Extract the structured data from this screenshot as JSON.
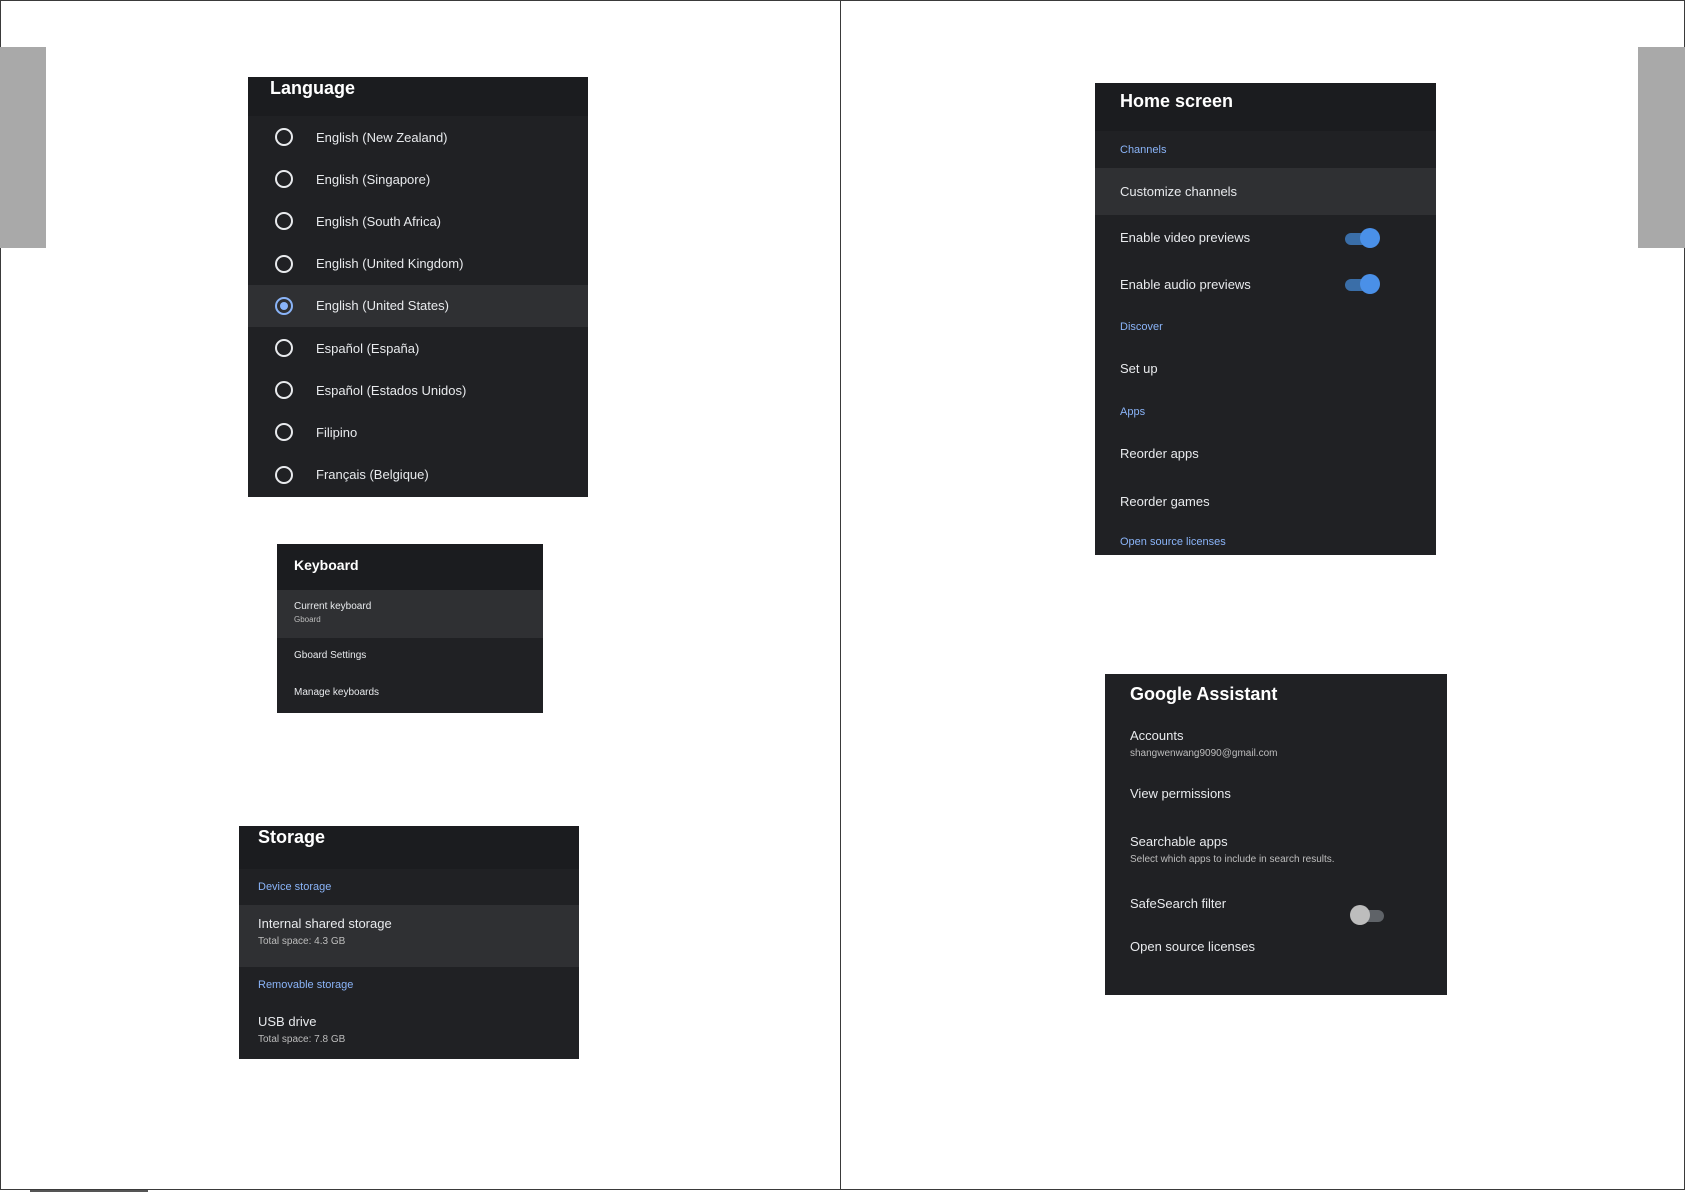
{
  "language": {
    "title": "Language",
    "options": [
      {
        "label": "English (New Zealand)",
        "selected": false
      },
      {
        "label": "English (Singapore)",
        "selected": false
      },
      {
        "label": "English (South Africa)",
        "selected": false
      },
      {
        "label": "English (United Kingdom)",
        "selected": false
      },
      {
        "label": "English (United States)",
        "selected": true
      },
      {
        "label": "Español (España)",
        "selected": false
      },
      {
        "label": "Español (Estados Unidos)",
        "selected": false
      },
      {
        "label": "Filipino",
        "selected": false
      },
      {
        "label": "Français (Belgique)",
        "selected": false
      }
    ]
  },
  "keyboard": {
    "title": "Keyboard",
    "current_label": "Current keyboard",
    "current_value": "Gboard",
    "gboard_settings": "Gboard Settings",
    "manage_keyboards": "Manage keyboards"
  },
  "storage": {
    "title": "Storage",
    "device_section": "Device storage",
    "internal_label": "Internal shared storage",
    "internal_total": "Total space: 4.3 GB",
    "removable_section": "Removable storage",
    "usb_label": "USB drive",
    "usb_total": "Total space: 7.8 GB"
  },
  "home_screen": {
    "title": "Home screen",
    "channels_section": "Channels",
    "customize_channels": "Customize channels",
    "video_previews": {
      "label": "Enable video previews",
      "on": true
    },
    "audio_previews": {
      "label": "Enable audio previews",
      "on": true
    },
    "discover_section": "Discover",
    "set_up": "Set up",
    "apps_section": "Apps",
    "reorder_apps": "Reorder apps",
    "reorder_games": "Reorder games",
    "open_source_licenses": "Open source licenses"
  },
  "google_assistant": {
    "title": "Google Assistant",
    "accounts_label": "Accounts",
    "accounts_email": "shangwenwang9090@gmail.com",
    "view_permissions": "View permissions",
    "searchable_apps": "Searchable apps",
    "searchable_apps_desc": "Select which apps to include in search results.",
    "safesearch": {
      "label": "SafeSearch filter",
      "on": false
    },
    "open_source_licenses": "Open source licenses"
  },
  "colors": {
    "panel_bg": "#202124",
    "header_bg": "#1b1c1f",
    "selected_bg": "#2f3033",
    "accent": "#8ab4f8",
    "toggle_on": "#4a90e8"
  }
}
